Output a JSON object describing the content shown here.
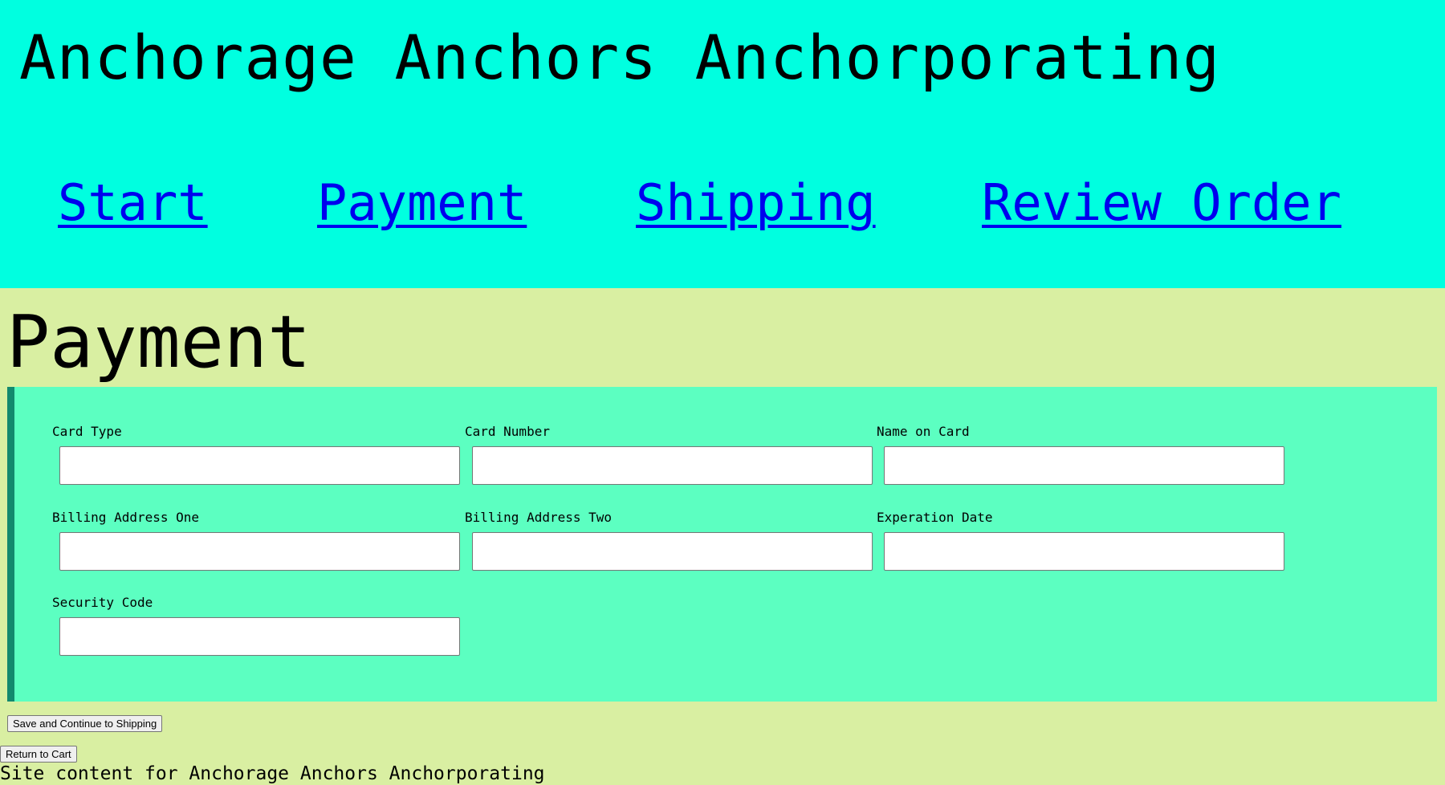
{
  "site": {
    "title": "Anchorage Anchors Anchorporating"
  },
  "nav": {
    "items": [
      {
        "label": "Start"
      },
      {
        "label": "Payment"
      },
      {
        "label": "Shipping"
      },
      {
        "label": "Review Order"
      }
    ]
  },
  "page": {
    "title": "Payment"
  },
  "form": {
    "fields": [
      {
        "label": "Card Type",
        "value": "",
        "placeholder": ""
      },
      {
        "label": "Card Number",
        "value": "",
        "placeholder": ""
      },
      {
        "label": "Name on Card",
        "value": "",
        "placeholder": ""
      },
      {
        "label": "Billing Address One",
        "value": "",
        "placeholder": ""
      },
      {
        "label": "Billing Address Two",
        "value": "",
        "placeholder": ""
      },
      {
        "label": "Experation Date",
        "value": "",
        "placeholder": ""
      },
      {
        "label": "Security Code",
        "value": "",
        "placeholder": ""
      }
    ]
  },
  "buttons": {
    "save_label": "Save and Continue to Shipping",
    "return_label": "Return to Cart"
  },
  "footer": {
    "text": "Site content for Anchorage Anchors Anchorporating"
  },
  "colors": {
    "header_bg": "#00ffe0",
    "page_bg": "#d9efa2",
    "panel_bg": "#5cffc1",
    "panel_border": "#13896e",
    "link": "#0000ee"
  }
}
